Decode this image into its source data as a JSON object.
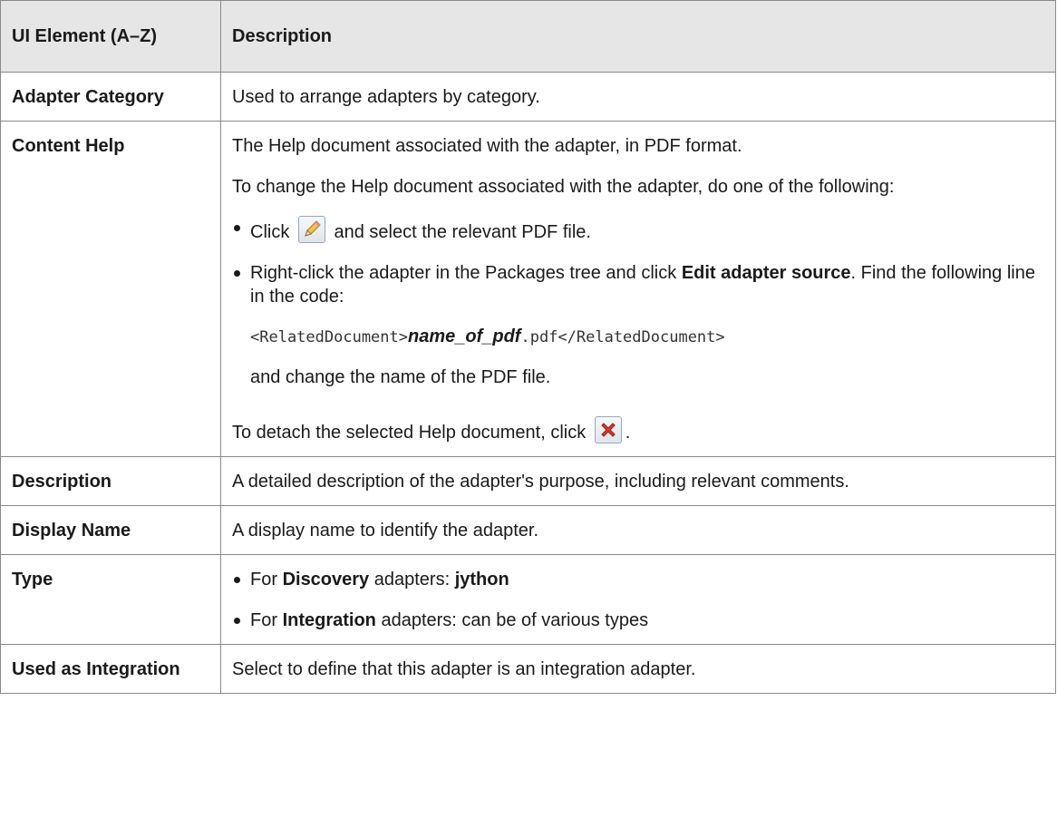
{
  "table": {
    "header": {
      "col1": "UI Element (A–Z)",
      "col2": "Description"
    },
    "rows": {
      "adapter_category": {
        "name": "Adapter Category",
        "desc": "Used to arrange adapters by category."
      },
      "content_help": {
        "name": "Content Help",
        "p1": "The Help document associated with the adapter, in PDF format.",
        "p2": "To change the Help document associated with the adapter, do one of the following:",
        "bullet1_before": "Click",
        "bullet1_after": "and select the relevant PDF file.",
        "bullet2_a": "Right-click the adapter in the Packages tree and click ",
        "bullet2_bold": "Edit adapter source",
        "bullet2_b": ". Find the following line in the code:",
        "code_pre": "<RelatedDocument>",
        "code_italic": "name_of_pdf",
        "code_post": ".pdf</RelatedDocument>",
        "code_followup": "and change the name of the PDF file.",
        "detach_text": "To detach the selected Help document, click",
        "detach_suffix": ".",
        "icons": {
          "edit": "pencil-edit-icon",
          "detach": "red-x-delete-icon"
        }
      },
      "description": {
        "name": "Description",
        "desc": "A detailed description of the adapter's purpose, including relevant comments."
      },
      "display_name": {
        "name": "Display Name",
        "desc": "A display name to identify the adapter."
      },
      "type": {
        "name": "Type",
        "b1_pre": "For ",
        "b1_bold": "Discovery",
        "b1_mid": " adapters: ",
        "b1_bold2": "jython",
        "b2_pre": "For ",
        "b2_bold": "Integration",
        "b2_post": " adapters: can be of various types"
      },
      "used_as_integration": {
        "name": "Used as Integration",
        "desc": "Select to define that this adapter is an integration adapter."
      }
    }
  },
  "colors": {
    "header_bg": "#e6e6e6",
    "border": "#8a8a8a"
  }
}
